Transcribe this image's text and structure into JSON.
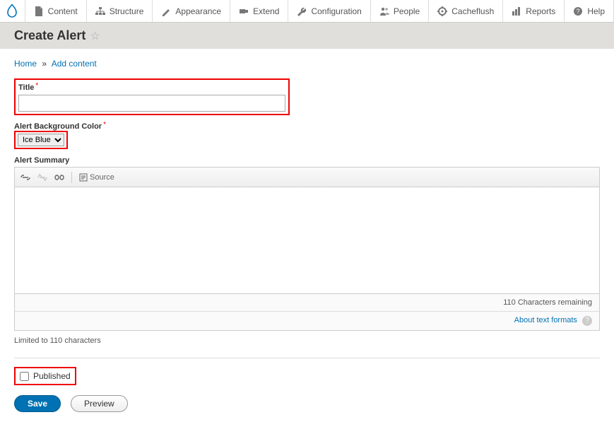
{
  "toolbar": {
    "items": [
      {
        "label": "Content"
      },
      {
        "label": "Structure"
      },
      {
        "label": "Appearance"
      },
      {
        "label": "Extend"
      },
      {
        "label": "Configuration"
      },
      {
        "label": "People"
      },
      {
        "label": "Cacheflush"
      },
      {
        "label": "Reports"
      },
      {
        "label": "Help"
      }
    ]
  },
  "page_title": "Create Alert",
  "breadcrumb": {
    "home": "Home",
    "add": "Add content"
  },
  "fields": {
    "title_label": "Title",
    "title_value": "",
    "bg_label": "Alert Background Color",
    "bg_value": "Ice Blue",
    "summary_label": "Alert Summary"
  },
  "editor": {
    "source_label": "Source",
    "chars_remaining": "110 Characters remaining",
    "about_formats": "About text formats"
  },
  "limit_note": "Limited to 110 characters",
  "published_label": "Published",
  "buttons": {
    "save": "Save",
    "preview": "Preview"
  }
}
